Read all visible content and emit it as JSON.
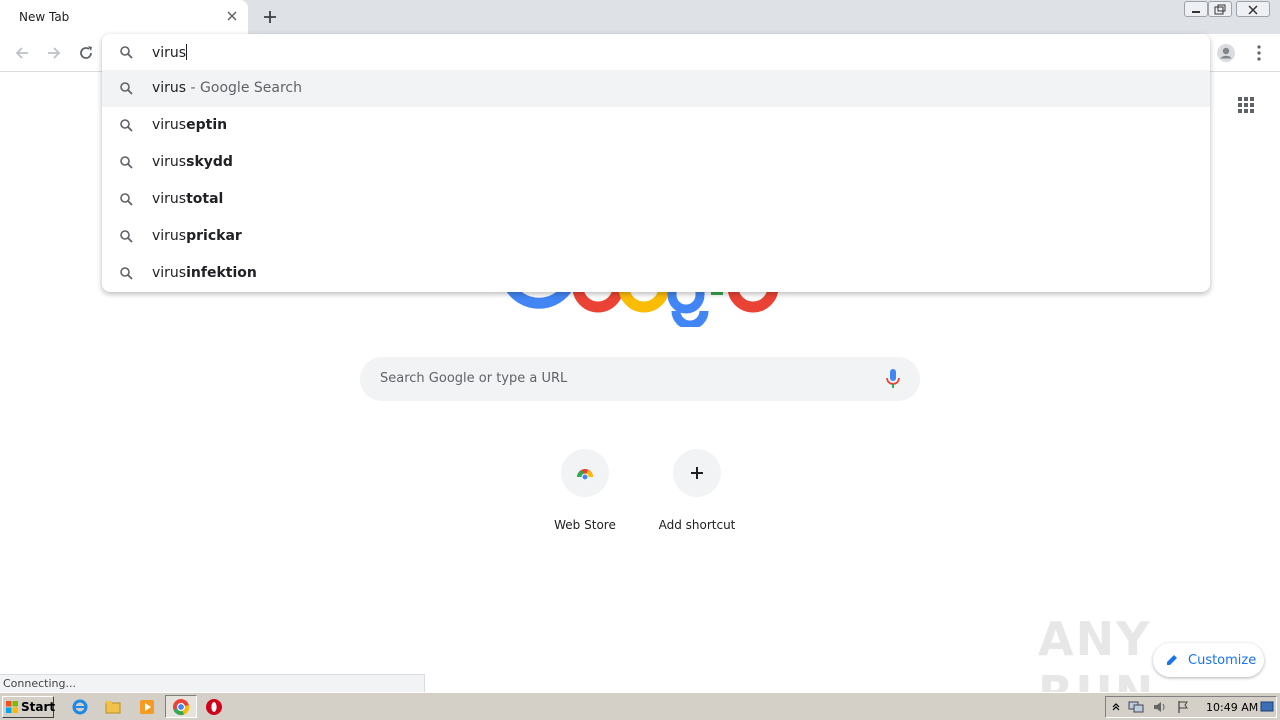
{
  "browser": {
    "tab_title": "New Tab",
    "omnibox_text": "virus",
    "suggestions": [
      {
        "prefix": "virus",
        "bold": "",
        "extra": " - Google Search",
        "selected": true
      },
      {
        "prefix": "virus",
        "bold": "eptin",
        "extra": "",
        "selected": false
      },
      {
        "prefix": "virus",
        "bold": "skydd",
        "extra": "",
        "selected": false
      },
      {
        "prefix": "virus",
        "bold": "total",
        "extra": "",
        "selected": false
      },
      {
        "prefix": "virus",
        "bold": "prickar",
        "extra": "",
        "selected": false
      },
      {
        "prefix": "virus",
        "bold": "infektion",
        "extra": "",
        "selected": false
      }
    ]
  },
  "ntp": {
    "search_placeholder": "Search Google or type a URL",
    "shortcuts": [
      {
        "label": "Web Store",
        "icon": "chrome-webstore-icon"
      },
      {
        "label": "Add shortcut",
        "icon": "plus-icon"
      }
    ],
    "customize_label": "Customize"
  },
  "watermark": "ANY RUN",
  "status_text": "Connecting...",
  "taskbar": {
    "start_label": "Start",
    "clock": "10:49 AM"
  },
  "colors": {
    "google_blue": "#4285f4",
    "google_red": "#ea4335",
    "google_yellow": "#fbbc05",
    "google_green": "#34a853",
    "accent": "#1a73e8"
  }
}
